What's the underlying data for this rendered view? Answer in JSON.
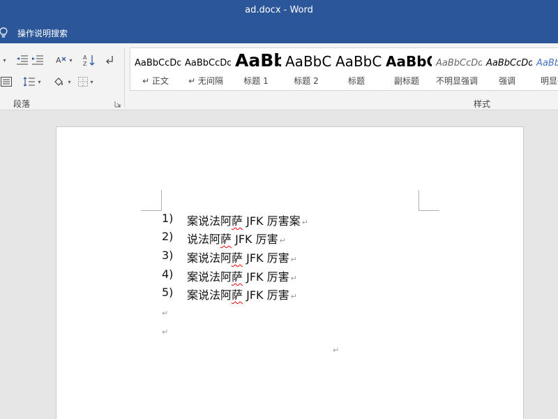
{
  "window": {
    "title": "ad.docx  -  Word"
  },
  "tell_me": {
    "label": "操作说明搜索"
  },
  "ribbon": {
    "paragraph_group_label": "段落",
    "styles_group_label": "样式",
    "styles": [
      {
        "sample": "AaBbCcDd",
        "name": "↵ 正文"
      },
      {
        "sample": "AaBbCcDd",
        "name": "↵ 无间隔"
      },
      {
        "sample": "AaBb",
        "name": "标题 1"
      },
      {
        "sample": "AaBbC",
        "name": "标题 2"
      },
      {
        "sample": "AaBbC",
        "name": "标题"
      },
      {
        "sample": "AaBbC",
        "name": "副标题"
      },
      {
        "sample": "AaBbCcDd",
        "name": "不明显强调"
      },
      {
        "sample": "AaBbCcDd",
        "name": "强调"
      },
      {
        "sample": "AaBbC",
        "name": "明显强调"
      }
    ]
  },
  "document": {
    "list_items": [
      {
        "number": "1)",
        "before": "案说法阿",
        "misspelled": "萨",
        "after": " JFK 厉害案"
      },
      {
        "number": "2)",
        "before": "说法阿",
        "misspelled": "萨",
        "after": " JFK 厉害"
      },
      {
        "number": "3)",
        "before": "案说法阿",
        "misspelled": "萨",
        "after": " JFK 厉害"
      },
      {
        "number": "4)",
        "before": "案说法阿",
        "misspelled": "萨",
        "after": " JFK 厉害"
      },
      {
        "number": "5)",
        "before": "案说法阿",
        "misspelled": "萨",
        "after": " JFK 厉害"
      }
    ],
    "paragraph_mark": "↵"
  },
  "colors": {
    "title_bar": "#2b579a",
    "ribbon": "#f3f3f3",
    "document_background": "#e6e6e6",
    "page": "#ffffff",
    "spell_error": "#e00000"
  },
  "icons": [
    "lightbulb-icon",
    "decrease-indent-icon",
    "increase-indent-icon",
    "text-direction-icon",
    "sort-icon",
    "show-marks-icon",
    "distributed-align-icon",
    "line-spacing-icon",
    "shading-icon",
    "borders-icon",
    "dialog-launcher-icon"
  ]
}
